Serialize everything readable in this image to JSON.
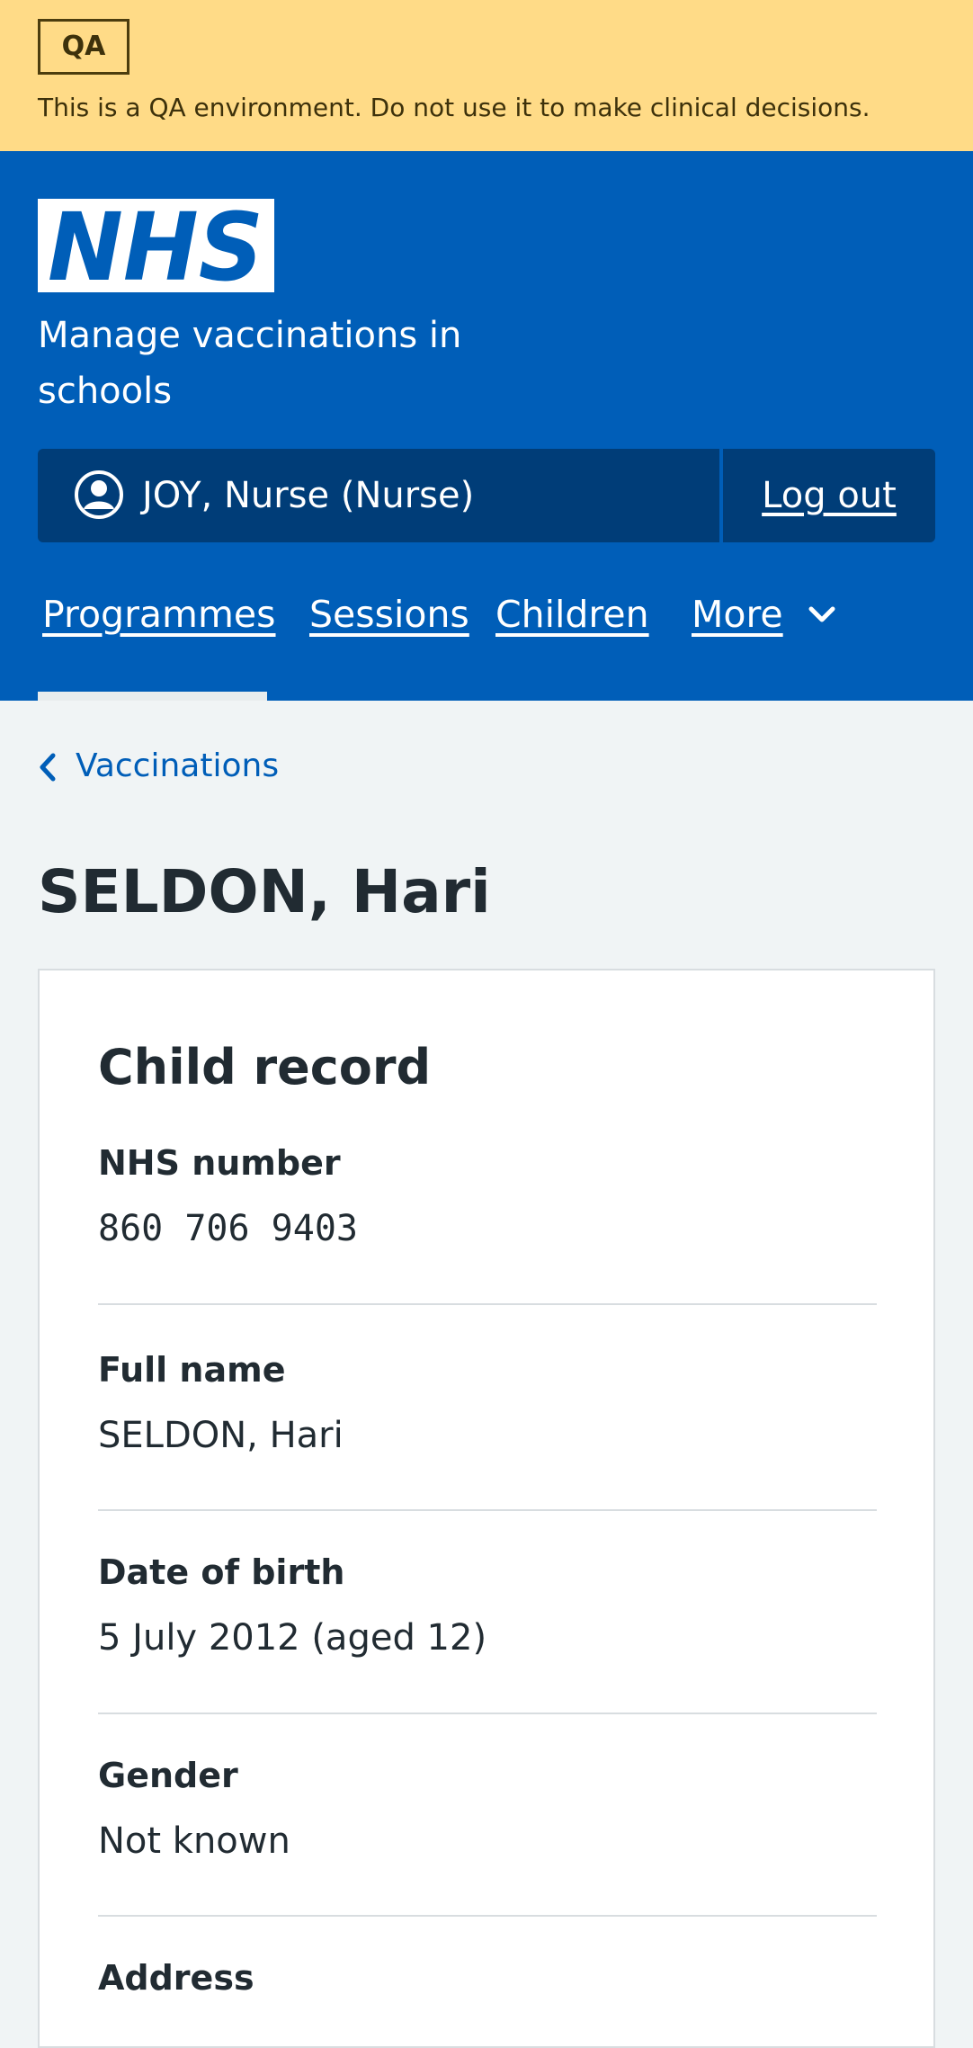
{
  "banner": {
    "tag": "QA",
    "message": "This is a QA environment. Do not use it to make clinical decisions."
  },
  "header": {
    "logo_text": "NHS",
    "service_name": "Manage vaccinations in schools",
    "user": "JOY, Nurse (Nurse)",
    "logout_label": "Log out",
    "nav": [
      {
        "label": "Programmes",
        "active": true
      },
      {
        "label": "Sessions",
        "active": false
      },
      {
        "label": "Children",
        "active": false
      },
      {
        "label": "More",
        "active": false
      }
    ]
  },
  "back_link": {
    "label": "Vaccinations"
  },
  "page": {
    "title": "SELDON, Hari"
  },
  "card": {
    "title": "Child record",
    "rows": [
      {
        "key": "NHS number",
        "value": "860 706 9403"
      },
      {
        "key": "Full name",
        "value": "SELDON, Hari"
      },
      {
        "key": "Date of birth",
        "value": "5 July 2012 (aged 12)"
      },
      {
        "key": "Gender",
        "value": "Not known"
      },
      {
        "key": "Address",
        "value": ""
      }
    ]
  },
  "colors": {
    "banner_bg": "#ffdb87",
    "header_bg": "#005eb8",
    "account_bg": "#003d78",
    "page_bg": "#f0f4f5",
    "link": "#005eb8",
    "text": "#212b32"
  }
}
